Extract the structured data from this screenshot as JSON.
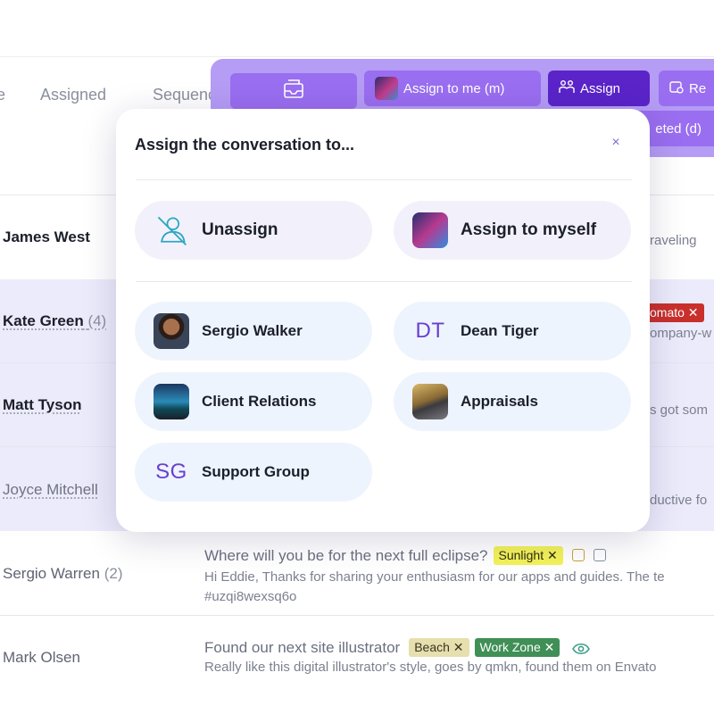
{
  "tabs": {
    "prev_fragment": "e",
    "assigned": "Assigned",
    "sequence": "Sequence"
  },
  "toolbar": {
    "assign_to_me": "Assign to me (m)",
    "assign": "Assign",
    "re_fragment": "Re",
    "completed_fragment": "eted (d)"
  },
  "rows": [
    {
      "name": "James West",
      "preview_fragment": "raveling"
    },
    {
      "name": "Kate Green",
      "count": "(4)",
      "tag": "omato",
      "preview_fragment": "ompany-w"
    },
    {
      "name": "Matt Tyson",
      "preview_fragment": "s got som"
    },
    {
      "name": "Joyce Mitchell",
      "preview_fragment": "ductive fo"
    },
    {
      "name": "Sergio Warren",
      "count": "(2)",
      "subject": "Where will you be for the next full eclipse?",
      "tag": "Sunlight",
      "preview": "Hi Eddie, Thanks for sharing your enthusiasm for our apps and guides. The te",
      "preview2": "#uzqi8wexsq6o"
    },
    {
      "name": "Mark Olsen",
      "subject": "Found our next site illustrator",
      "tag1": "Beach",
      "tag2": "Work Zone",
      "preview": "Really like this digital illustrator's style, goes by qmkn, found them on Envato"
    }
  ],
  "modal": {
    "title": "Assign the conversation to...",
    "close": "×",
    "unassign": "Unassign",
    "assign_myself": "Assign to myself",
    "entities": [
      {
        "label": "Sergio Walker",
        "kind": "photo"
      },
      {
        "label": "Dean Tiger",
        "initials": "DT"
      },
      {
        "label": "Client Relations",
        "kind": "photo"
      },
      {
        "label": "Appraisals",
        "kind": "photo"
      },
      {
        "label": "Support Group",
        "initials": "SG"
      }
    ]
  },
  "colors": {
    "toolbar": "#b59cf5",
    "toolbar_button": "#9a6ef0",
    "toolbar_button_active": "#5a24c9",
    "initials": "#6a3fd0",
    "selected_row": "#ecebfb"
  }
}
